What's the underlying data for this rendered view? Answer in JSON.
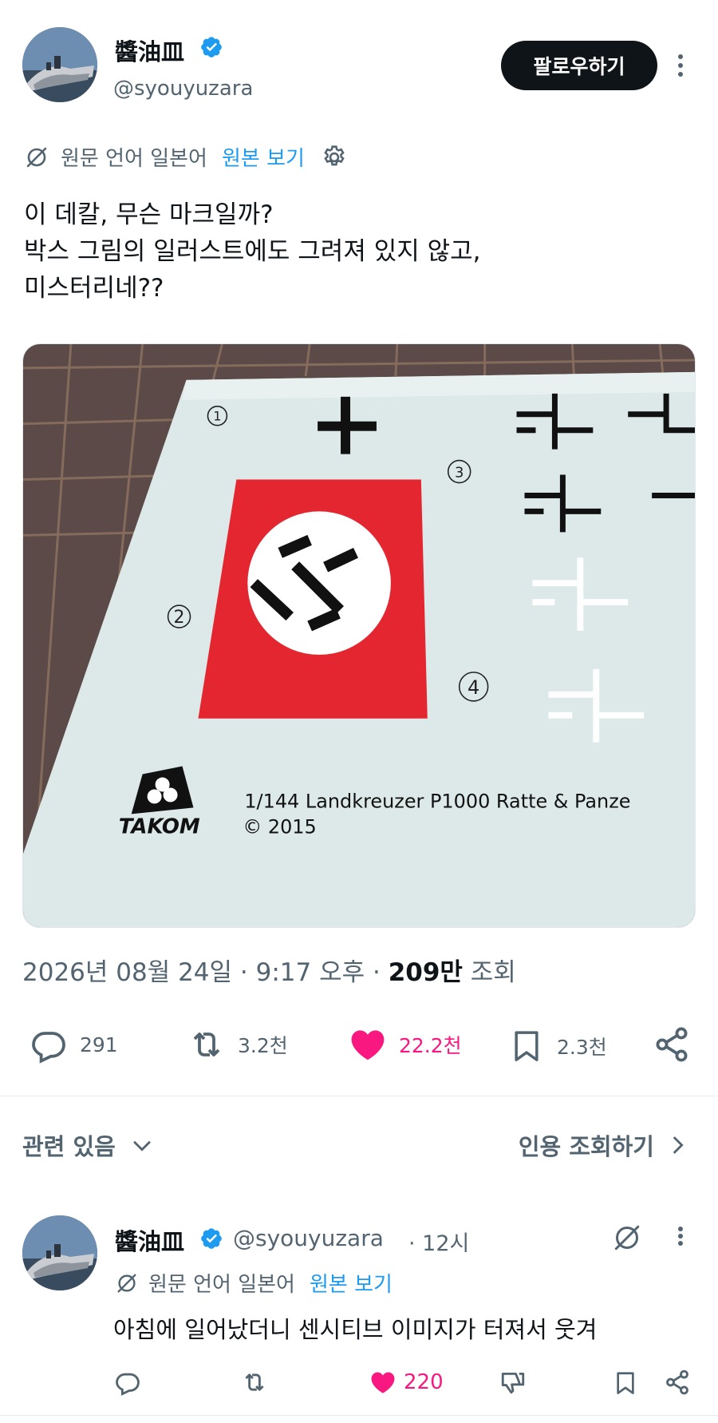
{
  "post": {
    "author_name": "醬油皿",
    "author_handle": "@syouyuzara",
    "follow_label": "팔로우하기",
    "translation": {
      "label": "원문 언어 일본어",
      "link": "원본 보기"
    },
    "text_lines": [
      "이 데칼, 무슨 마크일까?",
      "박스 그림의 일러스트에도 그려져 있지 않고,",
      "미스터리네??"
    ],
    "image": {
      "numbers": [
        "①",
        "②",
        "③",
        "④"
      ],
      "brand": "TAKOM",
      "caption_line1": "1/144 Landkreuzer P1000 Ratte & Panze",
      "caption_line2": "© 2015",
      "colors": {
        "decal_paper": "#dce9e8",
        "flag_red": "#e3262f",
        "mat": "#5b4a48"
      }
    },
    "timestamp": "2026년 08월 24일 · 9:17 오후 · ",
    "views_count": "209만",
    "views_label": " 조회",
    "actions": {
      "replies": "291",
      "reposts": "3.2천",
      "likes": "22.2천",
      "bookmarks": "2.3천"
    },
    "colors": {
      "like": "#f91880",
      "link": "#1d9bf0",
      "verified": "#1d9bf0"
    }
  },
  "related": {
    "label": "관련 있음",
    "quote_label": "인용 조회하기"
  },
  "reply": {
    "author_name": "醬油皿",
    "author_handle": "@syouyuzara",
    "time": "· 12시",
    "translation": {
      "label": "원문 언어 일본어",
      "link": "원본 보기"
    },
    "text": "아침에 일어났더니 센시티브 이미지가 터져서 웃겨",
    "likes": "220"
  }
}
